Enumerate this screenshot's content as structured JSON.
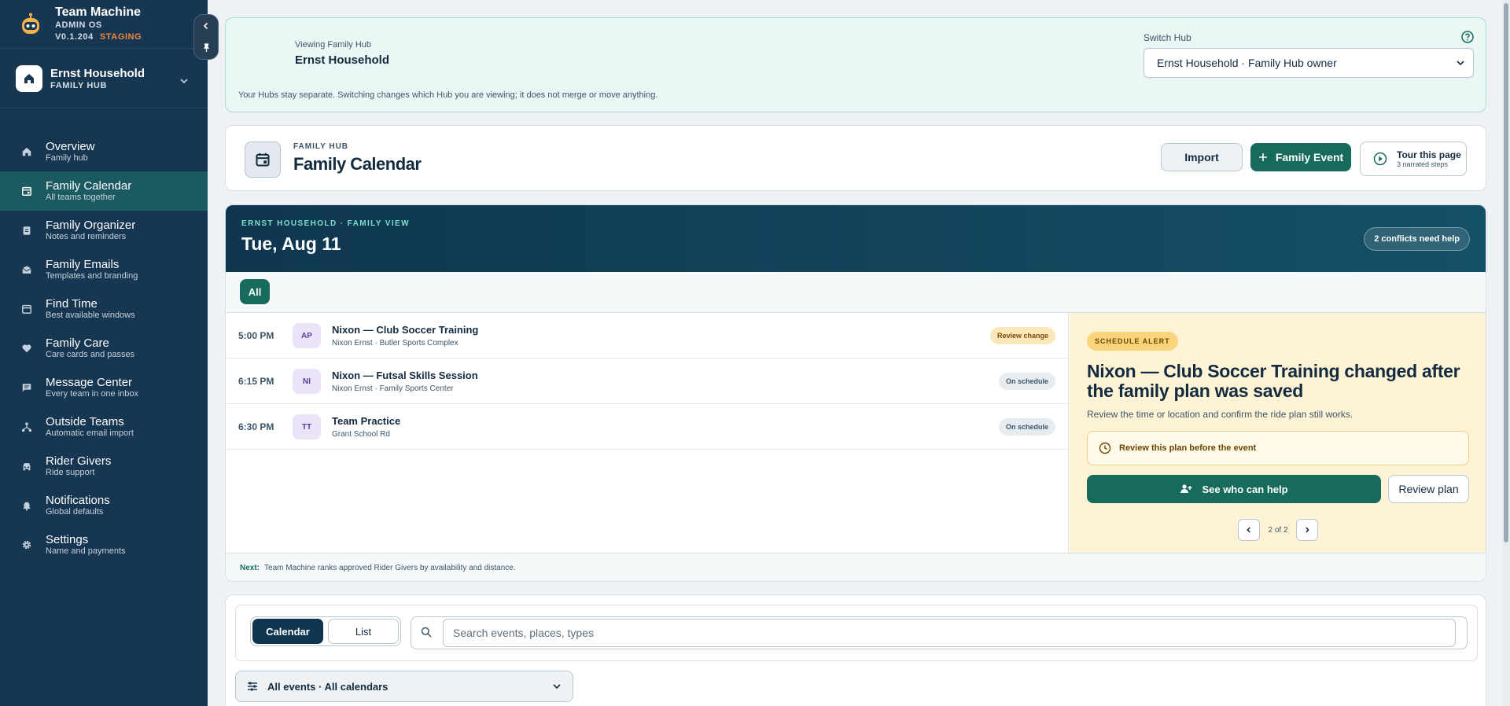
{
  "brand": {
    "name": "Team Machine",
    "subtitle": "ADMIN OS",
    "version": "V0.1.204",
    "env": "STAGING"
  },
  "hub_selector": {
    "name": "Ernst Household",
    "type": "FAMILY HUB"
  },
  "nav": [
    {
      "label": "Overview",
      "sub": "Family hub",
      "icon": "home-icon"
    },
    {
      "label": "Family Calendar",
      "sub": "All teams together",
      "icon": "calendar-icon",
      "active": true
    },
    {
      "label": "Family Organizer",
      "sub": "Notes and reminders",
      "icon": "clipboard-icon"
    },
    {
      "label": "Family Emails",
      "sub": "Templates and branding",
      "icon": "mail-icon"
    },
    {
      "label": "Find Time",
      "sub": "Best available windows",
      "icon": "calendar-blank-icon"
    },
    {
      "label": "Family Care",
      "sub": "Care cards and passes",
      "icon": "heart-icon"
    },
    {
      "label": "Message Center",
      "sub": "Every team in one inbox",
      "icon": "chat-icon"
    },
    {
      "label": "Outside Teams",
      "sub": "Automatic email import",
      "icon": "network-icon"
    },
    {
      "label": "Rider Givers",
      "sub": "Ride support",
      "icon": "car-icon"
    },
    {
      "label": "Notifications",
      "sub": "Global defaults",
      "icon": "bell-icon"
    },
    {
      "label": "Settings",
      "sub": "Name and payments",
      "icon": "gear-icon"
    }
  ],
  "hub_card": {
    "viewing_label": "Viewing Family Hub",
    "hub_name": "Ernst Household",
    "note": "Your Hubs stay separate. Switching changes which Hub you are viewing; it does not merge or move anything.",
    "switch_label": "Switch Hub",
    "switch_value": "Ernst Household · Family Hub owner"
  },
  "page_header": {
    "eyebrow": "FAMILY HUB",
    "title": "Family Calendar",
    "import_label": "Import",
    "event_label": "Family Event",
    "tour_title": "Tour this page",
    "tour_sub": "3 narrated steps"
  },
  "day": {
    "eyebrow": "ERNST HOUSEHOLD · FAMILY VIEW",
    "date": "Tue, Aug 11",
    "conflicts": "2 conflicts need help",
    "filter_all": "All"
  },
  "events": [
    {
      "time": "5:00 PM",
      "badge": "AP",
      "title": "Nixon — Club Soccer Training",
      "sub": "Nixon Ernst · Butler Sports Complex",
      "status": "Review change",
      "status_kind": "warn"
    },
    {
      "time": "6:15 PM",
      "badge": "NI",
      "title": "Nixon — Futsal Skills Session",
      "sub": "Nixon Ernst · Family Sports Center",
      "status": "On schedule",
      "status_kind": "ok"
    },
    {
      "time": "6:30 PM",
      "badge": "TT",
      "title": "Team Practice",
      "sub": "Grant School Rd",
      "status": "On schedule",
      "status_kind": "ok"
    }
  ],
  "alert": {
    "tag": "SCHEDULE ALERT",
    "title": "Nixon — Club Soccer Training changed after the family plan was saved",
    "desc": "Review the time or location and confirm the ride plan still works.",
    "box_text": "Review this plan before the event",
    "help_button": "See who can help",
    "review_button": "Review plan",
    "pager": "2 of 2"
  },
  "footer": {
    "next_label": "Next:",
    "next_text": "Team Machine ranks approved Rider Givers by availability and distance."
  },
  "toolbar": {
    "calendar_label": "Calendar",
    "list_label": "List",
    "search_placeholder": "Search events, places, types",
    "filter_label": "All events · All calendars"
  },
  "colors": {
    "sidebar": "#163651",
    "accent": "#176b5d",
    "alert_bg": "#fef3d4",
    "staging": "#f0873a"
  }
}
